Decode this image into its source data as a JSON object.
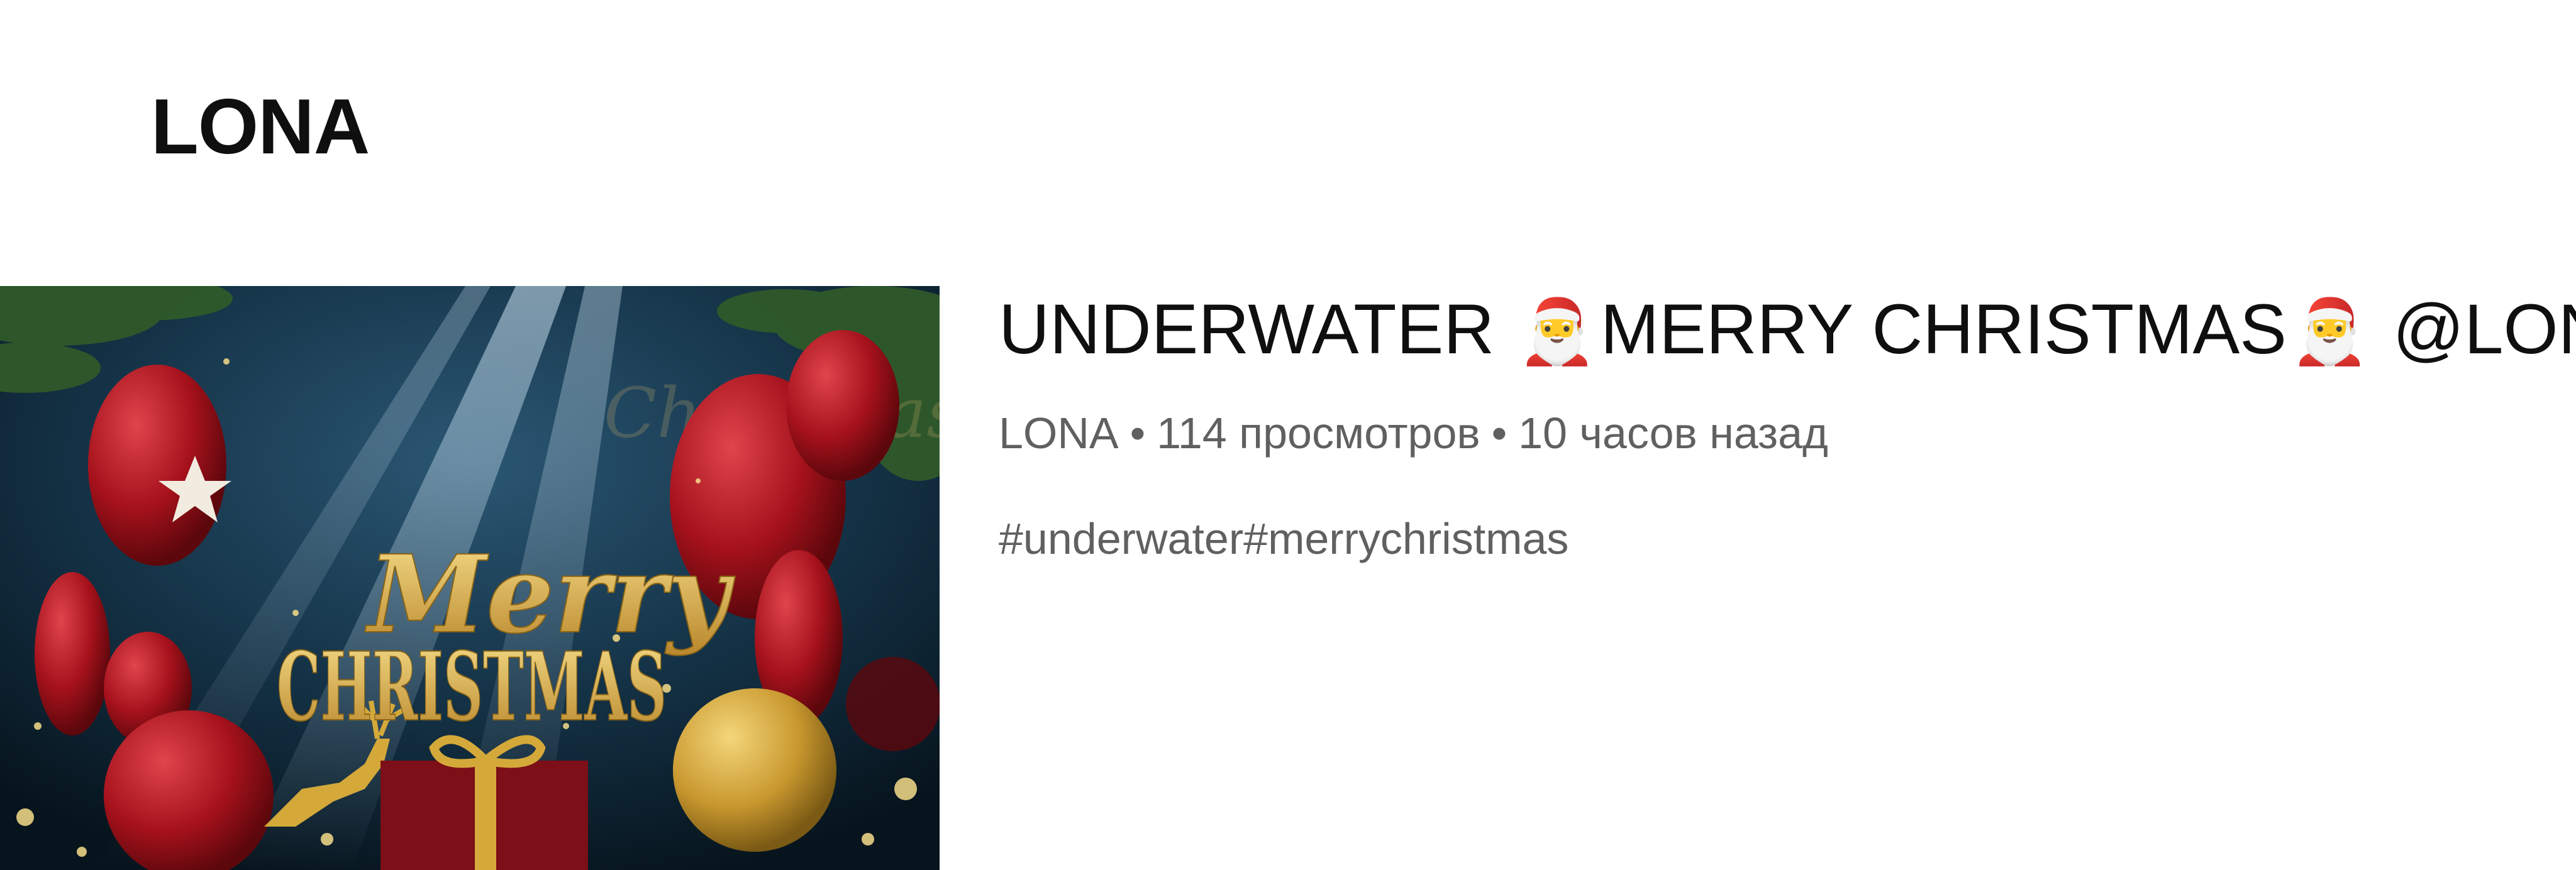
{
  "section": {
    "channel_title": "LONA"
  },
  "video": {
    "title_part1": "UNDERWATER",
    "title_part2": "MERRY CHRISTMAS",
    "title_part3": "@LONA_",
    "title_emoji": "🎅",
    "channel_name": "LONA",
    "separator": "•",
    "views": "114 просмотров",
    "time_ago": "10 часов назад",
    "description": "#underwater#merrychristmas",
    "thumbnail": {
      "merry_text": "Merry",
      "christmas_text": "CHRISTMAS",
      "colors": {
        "background": "#0b2231",
        "balloon_red": "#b3121c",
        "gold": "#d4a93a",
        "foliage": "#2f5a2a"
      }
    }
  }
}
